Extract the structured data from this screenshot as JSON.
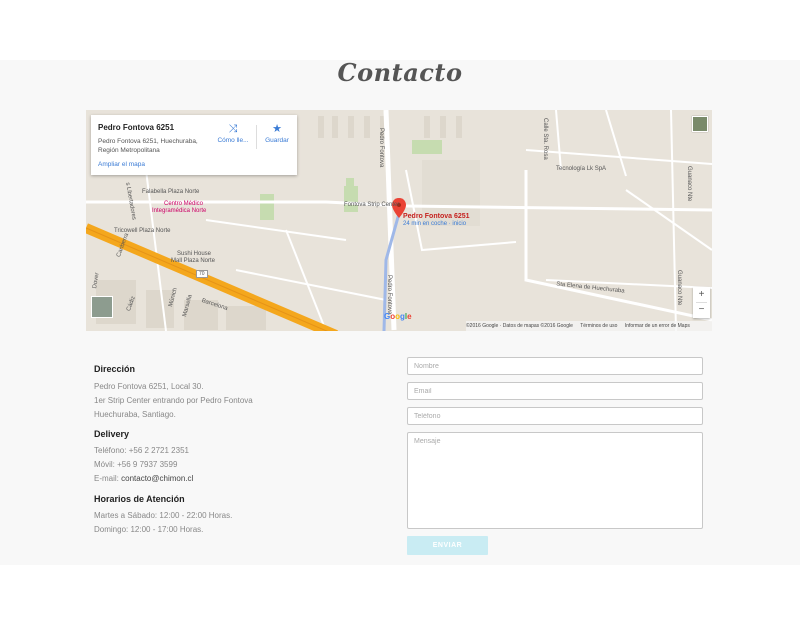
{
  "page": {
    "title": "Contacto"
  },
  "map": {
    "info_card": {
      "name": "Pedro Fontova 6251",
      "address_line1": "Pedro Fontova 6251, Huechuraba,",
      "address_line2": "Región Metropolitana",
      "enlarge_link": "Ampliar el mapa",
      "directions_label": "Cómo lle...",
      "save_label": "Guardar"
    },
    "pin_label": "Pedro Fontova 6251",
    "pin_sublabel": "24 min en coche · inicio",
    "places": {
      "falabella": "Falabella Plaza Norte",
      "centro_medico_1": "Centro Médico",
      "centro_medico_2": "Integramédica Norte",
      "tricowell": "Tricowell Plaza Norte",
      "sushi_1": "Sushi House",
      "sushi_2": "Mall Plaza Norte",
      "strip_center": "Fontova Strip Center",
      "tecnologia": "Tecnología Lk SpA",
      "sta_elena": "Sta Elena de Huechuraba",
      "barcelona": "Barcelona",
      "pedro_fontova_road": "Pedro Fontova",
      "pedro_fontova_road2": "Pedro Fontova",
      "libertadores": "s Libertadores",
      "calle_sta_rosa": "Calle Sta. Rosa",
      "guanaco_1": "Guanaco Nte",
      "guanaco_2": "Guanaco Nte",
      "canberra": "Canberra",
      "dover": "Dover",
      "cadiz": "Cádiz",
      "munich": "Múnich",
      "marsella": "Marsella",
      "road_70": "70"
    },
    "google": "Google",
    "footer": {
      "copyright": "©2016 Google · Datos de mapas ©2016 Google",
      "terms": "Términos de uso",
      "report": "Informar de un error de Maps"
    },
    "zoom_in": "+",
    "zoom_out": "−"
  },
  "contact": {
    "address": {
      "heading": "Dirección",
      "line1": "Pedro Fontova 6251, Local 30.",
      "line2": "1er Strip Center entrando por Pedro Fontova",
      "line3": "Huechuraba, Santiago."
    },
    "delivery": {
      "heading": "Delivery",
      "phone": "Teléfono: +56 2 2721 2351",
      "mobile": "Móvil: +56 9 7937 3599",
      "email_label": "E-mail: ",
      "email_value": "contacto@chimon.cl"
    },
    "hours": {
      "heading": "Horarios de Atención",
      "weekdays": "Martes a Sábado: 12:00 - 22:00 Horas.",
      "sunday": "Domingo: 12:00 - 17:00 Horas."
    }
  },
  "form": {
    "name_placeholder": "Nombre",
    "email_placeholder": "Email",
    "phone_placeholder": "Teléfono",
    "message_placeholder": "Mensaje",
    "submit_label": "ENVIAR"
  },
  "colors": {
    "accent": "#c9ecf3",
    "highway": "#f4a71d",
    "pin": "#ea4335",
    "link": "#3a7bd5"
  }
}
